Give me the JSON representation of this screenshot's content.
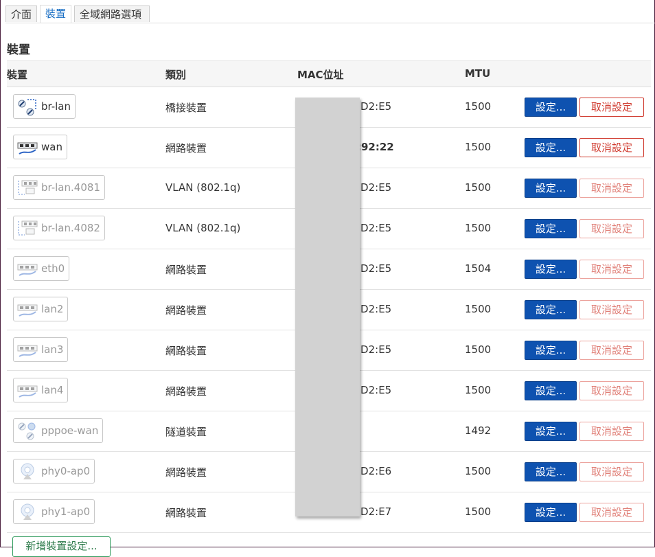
{
  "tabs": [
    {
      "label": "介面",
      "active": false
    },
    {
      "label": "裝置",
      "active": true
    },
    {
      "label": "全域網路選項",
      "active": false
    }
  ],
  "section_title": "裝置",
  "columns": [
    "裝置",
    "類別",
    "MAC位址",
    "MTU"
  ],
  "rows": [
    {
      "name": "br-lan",
      "type": "橋接裝置",
      "mac": ":D2:E5",
      "mtu": "1500",
      "icon": "bridge-icon",
      "dim": false,
      "mac_bold": false
    },
    {
      "name": "wan",
      "type": "網路裝置",
      "mac": ":92:22",
      "mtu": "1500",
      "icon": "ethernet-icon",
      "dim": false,
      "mac_bold": true
    },
    {
      "name": "br-lan.4081",
      "type": "VLAN (802.1q)",
      "mac": ":D2:E5",
      "mtu": "1500",
      "icon": "vlan-icon",
      "dim": true,
      "mac_bold": false
    },
    {
      "name": "br-lan.4082",
      "type": "VLAN (802.1q)",
      "mac": ":D2:E5",
      "mtu": "1500",
      "icon": "vlan-icon",
      "dim": true,
      "mac_bold": false
    },
    {
      "name": "eth0",
      "type": "網路裝置",
      "mac": ":D2:E5",
      "mtu": "1504",
      "icon": "ethernet-icon",
      "dim": true,
      "mac_bold": false
    },
    {
      "name": "lan2",
      "type": "網路裝置",
      "mac": ":D2:E5",
      "mtu": "1500",
      "icon": "ethernet-icon",
      "dim": true,
      "mac_bold": false
    },
    {
      "name": "lan3",
      "type": "網路裝置",
      "mac": ":D2:E5",
      "mtu": "1500",
      "icon": "ethernet-icon",
      "dim": true,
      "mac_bold": false
    },
    {
      "name": "lan4",
      "type": "網路裝置",
      "mac": ":D2:E5",
      "mtu": "1500",
      "icon": "ethernet-icon",
      "dim": true,
      "mac_bold": false
    },
    {
      "name": "pppoe-wan",
      "type": "隧道裝置",
      "mac": "",
      "mtu": "1492",
      "icon": "tunnel-icon",
      "dim": true,
      "mac_bold": false
    },
    {
      "name": "phy0-ap0",
      "type": "網路裝置",
      "mac": ":D2:E6",
      "mtu": "1500",
      "icon": "wifi-icon",
      "dim": true,
      "mac_bold": false
    },
    {
      "name": "phy1-ap0",
      "type": "網路裝置",
      "mac": ":D2:E7",
      "mtu": "1500",
      "icon": "wifi-icon",
      "dim": true,
      "mac_bold": false
    }
  ],
  "set_label": "設定...",
  "unset_label": "取消設定",
  "add_label": "新增裝置設定..."
}
